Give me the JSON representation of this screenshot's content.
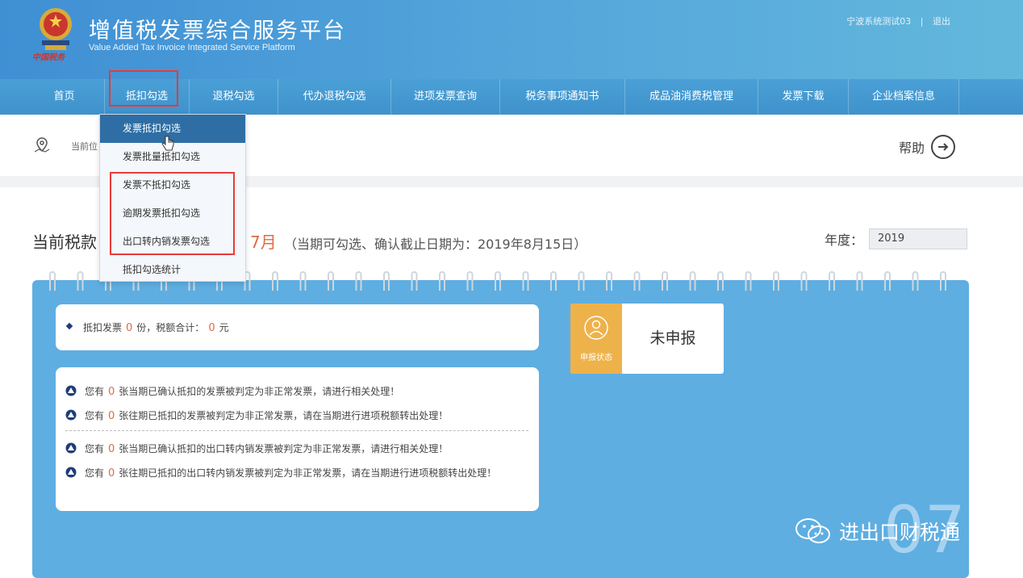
{
  "header": {
    "title_cn": "增值税发票综合服务平台",
    "title_en": "Value Added Tax Invoice Integrated Service Platform",
    "logo_text": "中国税务",
    "user": "宁波系统测试03",
    "separator": "|",
    "logout": "退出"
  },
  "nav": {
    "items": [
      {
        "label": "首页"
      },
      {
        "label": "抵扣勾选"
      },
      {
        "label": "退税勾选"
      },
      {
        "label": "代办退税勾选"
      },
      {
        "label": "进项发票查询"
      },
      {
        "label": "税务事项通知书"
      },
      {
        "label": "成品油消费税管理"
      },
      {
        "label": "发票下载"
      },
      {
        "label": "企业档案信息"
      }
    ]
  },
  "dropdown": {
    "items": [
      {
        "label": "发票抵扣勾选"
      },
      {
        "label": "发票批量抵扣勾选"
      },
      {
        "label": "发票不抵扣勾选"
      },
      {
        "label": "逾期发票抵扣勾选"
      },
      {
        "label": "出口转内销发票勾选"
      },
      {
        "label": "抵扣勾选统计"
      }
    ]
  },
  "breadcrumb": {
    "text": "当前位"
  },
  "help": {
    "label": "帮助"
  },
  "period": {
    "title": "当前税款",
    "month": "7月",
    "note": "（当期可勾选、确认截止日期为：2019年8月15日）"
  },
  "year": {
    "label": "年度：",
    "value": "2019"
  },
  "summary": {
    "prefix": "抵扣发票",
    "count": "0",
    "middle": "份，税额合计：",
    "amount": "0",
    "suffix": "元"
  },
  "warnings": [
    {
      "pre": "您有",
      "count": "0",
      "text": "张当期已确认抵扣的发票被判定为非正常发票，请进行相关处理！"
    },
    {
      "pre": "您有",
      "count": "0",
      "text": "张往期已抵扣的发票被判定为非正常发票，请在当期进行进项税额转出处理！"
    },
    {
      "pre": "您有",
      "count": "0",
      "text": "张当期已确认抵扣的出口转内销发票被判定为非正常发票，请进行相关处理！"
    },
    {
      "pre": "您有",
      "count": "0",
      "text": "张往期已抵扣的出口转内销发票被判定为非正常发票，请在当期进行进项税额转出处理！"
    }
  ],
  "status": {
    "icon_label": "申报状态",
    "text": "未申报"
  },
  "big_month": "07",
  "watermark": {
    "text": "进出口财税通"
  },
  "colors": {
    "header": "#4a9bd8",
    "accent": "#e06a43",
    "board": "#5eaee2",
    "status": "#eeb24b",
    "highlight": "#e83a3a"
  }
}
